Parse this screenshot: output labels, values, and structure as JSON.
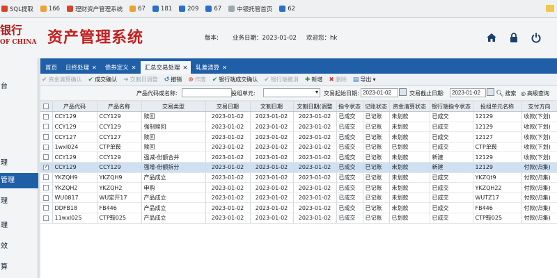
{
  "bookmarks": [
    {
      "label": "SQL提取",
      "icon": "database-icon"
    },
    {
      "label": "166",
      "icon": "bookmark-icon"
    },
    {
      "label": "理财资产管理系统",
      "icon": "bookmark-icon"
    },
    {
      "label": "67",
      "icon": "bookmark-icon"
    },
    {
      "label": "181",
      "icon": "bookmark-icon"
    },
    {
      "label": "209",
      "icon": "bookmark-icon"
    },
    {
      "label": "67",
      "icon": "bookmark-icon"
    },
    {
      "label": "中银托管首页",
      "icon": "page-icon"
    },
    {
      "label": "62",
      "icon": "bookmark-icon"
    }
  ],
  "header": {
    "bank_name": "银行",
    "bank_en": "OF CHINA",
    "system_title": "资产管理系统",
    "version_label": "版本:",
    "business_date": "业务日期：2023-01-02",
    "welcome": "欢迎您：hk"
  },
  "sidebar": {
    "items": [
      "台",
      "",
      "",
      "理",
      "管理",
      "理",
      "理",
      "效",
      "算"
    ],
    "active_index": 4
  },
  "tabs": [
    {
      "label": "首页",
      "closable": false,
      "active": false
    },
    {
      "label": "日终处理",
      "closable": true,
      "active": false
    },
    {
      "label": "债券定义",
      "closable": true,
      "active": false
    },
    {
      "label": "汇总交易处理",
      "closable": true,
      "active": true
    },
    {
      "label": "轧差清算",
      "closable": true,
      "active": false
    }
  ],
  "toolbar": [
    {
      "label": "资金清算确认",
      "icon": "check-icon",
      "enabled": false,
      "color": "#9aa3ab"
    },
    {
      "label": "成交确认",
      "icon": "check-icon",
      "enabled": true,
      "color": "#2e8b3e"
    },
    {
      "label": "交割日调整",
      "icon": "arrow-icon",
      "enabled": false,
      "color": "#9aa3ab"
    },
    {
      "label": "撤销",
      "icon": "undo-icon",
      "enabled": true,
      "color": "#2a6fc9"
    },
    {
      "label": "作废",
      "icon": "cancel-icon",
      "enabled": false,
      "color": "#e05a3a"
    },
    {
      "label": "银行端成交确认",
      "icon": "check-icon",
      "enabled": true,
      "color": "#2e8b3e"
    },
    {
      "label": "银行端撤消",
      "icon": "check-icon",
      "enabled": false,
      "color": "#9aa3ab"
    },
    {
      "label": "新增",
      "icon": "plus-icon",
      "enabled": true,
      "color": "#2e8b3e"
    },
    {
      "label": "删除",
      "icon": "delete-icon",
      "enabled": false,
      "color": "#d04030"
    },
    {
      "label": "导出",
      "icon": "export-icon",
      "enabled": true,
      "color": "#2a6fc9"
    }
  ],
  "filters": {
    "product_label": "产品代码或名称:",
    "product_value": "",
    "unit_label": "投组单元:",
    "unit_value": "",
    "start_label": "交易起始日期:",
    "start_value": "2023-01-02",
    "end_label": "交易截止日期:",
    "end_value": "2023-01-02",
    "search_label": "搜索",
    "advanced_label": "高级查询"
  },
  "table": {
    "columns": [
      "产品代码",
      "产品名称",
      "交易类型",
      "交易日期",
      "文割日期",
      "文割日期(调整",
      "指令状态",
      "记账状态",
      "资金清算状态",
      "银行端指令状态",
      "投组单元名称",
      "支付方向"
    ],
    "rows": [
      {
        "selected": false,
        "cells": [
          "CCY129",
          "CCY129",
          "赎回",
          "2023-01-02",
          "2023-01-02",
          "2023-01-02",
          "已成交",
          "已记账",
          "未划款",
          "已成交",
          "12129",
          "收款(下划)"
        ]
      },
      {
        "selected": false,
        "cells": [
          "CCY129",
          "CCY129",
          "强制赎回",
          "2023-01-02",
          "2023-01-02",
          "2023-01-02",
          "已成交",
          "已记账",
          "未划款",
          "已成交",
          "12129",
          "收款(下划)"
        ]
      },
      {
        "selected": false,
        "cells": [
          "CCY127",
          "CCY127",
          "赎回",
          "2023-01-02",
          "2023-01-02",
          "2023-01-02",
          "已成交",
          "已记账",
          "未划款",
          "已成交",
          "12127",
          "收款(下划)"
        ]
      },
      {
        "selected": false,
        "cells": [
          "1wxl024",
          "CTP单鞍",
          "赎回",
          "2023-01-02",
          "2023-01-02",
          "2023-01-02",
          "已成交",
          "已记账",
          "已划款",
          "已成交",
          "CTP单鞍",
          "收款(下划)"
        ]
      },
      {
        "selected": false,
        "cells": [
          "CCY129",
          "CCY129",
          "强减-份额合并",
          "2023-01-02",
          "2023-01-02",
          "2023-01-02",
          "已成交",
          "已记账",
          "未划款",
          "新建",
          "12129",
          "收款(下划)"
        ]
      },
      {
        "selected": true,
        "cells": [
          "CCY129",
          "CCY129",
          "强增-份额拆分",
          "2023-01-02",
          "2023-01-02",
          "2023-01-02",
          "已成交",
          "已记账",
          "未划款",
          "新建",
          "12129",
          "付款(归集)"
        ]
      },
      {
        "selected": false,
        "cells": [
          "YKZQH9",
          "YKZQH9",
          "产品成立",
          "2023-01-02",
          "2023-01-02",
          "2023-01-02",
          "已成交",
          "已记账",
          "未划款",
          "已成交",
          "YKZQt9",
          "付款(归集)"
        ]
      },
      {
        "selected": false,
        "cells": [
          "YKZQH2",
          "YKZQH2",
          "申购",
          "2023-01-02",
          "2023-01-02",
          "2023-01-02",
          "已成交",
          "已记账",
          "未划款",
          "已成交",
          "YKZQH22",
          "付款(归集)"
        ]
      },
      {
        "selected": false,
        "cells": [
          "WU0817",
          "WU定开17",
          "产品成立",
          "2023-01-02",
          "2023-01-02",
          "2023-01-02",
          "已成交",
          "已记账",
          "未划款",
          "已成交",
          "WUTZ17",
          "付款(归集)"
        ]
      },
      {
        "selected": false,
        "cells": [
          "DDFB18",
          "FB446",
          "产品成立",
          "2023-01-02",
          "2023-01-02",
          "2023-01-02",
          "已成交",
          "已记账",
          "未划款",
          "已成交",
          "FB446",
          "付款(归集)"
        ]
      },
      {
        "selected": false,
        "cells": [
          "11wxl025",
          "CTP鞍025",
          "产品成立",
          "2023-01-02",
          "2023-01-02",
          "2023-01-02",
          "已成交",
          "已记账",
          "已划款",
          "已成交",
          "CTP鞍025",
          "付款(归集)"
        ]
      }
    ]
  },
  "colors": {
    "accent": "#1f5fa8",
    "title_red": "#c41e1e",
    "selected_row": "#cfe0f2"
  }
}
